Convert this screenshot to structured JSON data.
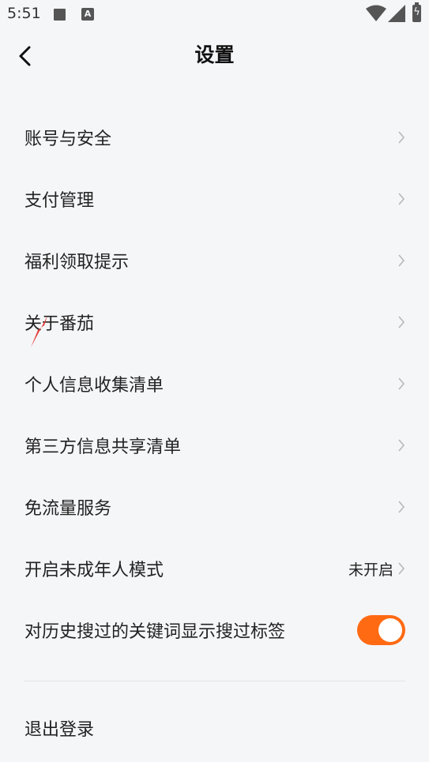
{
  "status_bar": {
    "time": "5:51",
    "icons": [
      "stop-square-icon",
      "a-notification-icon",
      "wifi-icon",
      "signal-icon",
      "battery-charging-icon"
    ]
  },
  "header": {
    "title": "设置",
    "back_icon": "chevron-left-icon"
  },
  "settings": {
    "items": [
      {
        "label": "账号与安全"
      },
      {
        "label": "支付管理"
      },
      {
        "label": "福利领取提示"
      },
      {
        "label": "关于番茄"
      },
      {
        "label": "个人信息收集清单"
      },
      {
        "label": "第三方信息共享清单"
      },
      {
        "label": "免流量服务"
      },
      {
        "label": "开启未成年人模式",
        "value": "未开启"
      },
      {
        "label": "对历史搜过的关键词显示搜过标签",
        "toggle": true
      }
    ]
  },
  "logout": {
    "label": "退出登录"
  },
  "colors": {
    "accent": "#ff6a13",
    "background": "#f5f6f8",
    "text": "#222222"
  }
}
